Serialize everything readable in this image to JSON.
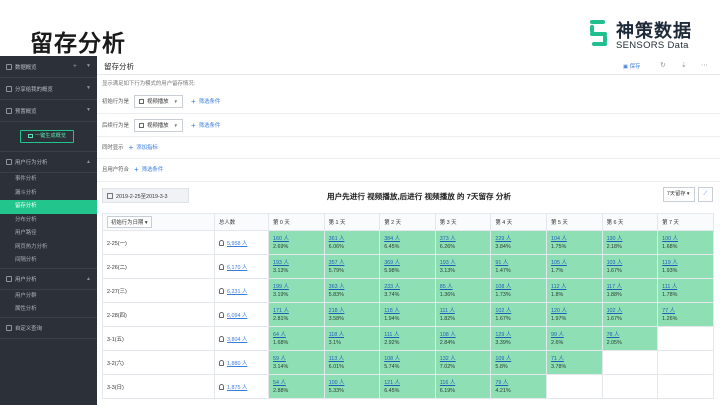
{
  "slide": {
    "title": "留存分析",
    "logo": {
      "cn": "神策数据",
      "en": "SENSORS Data"
    }
  },
  "sidebar": {
    "sections": [
      {
        "label": "数据概览"
      },
      {
        "label": "分享给我的概览"
      },
      {
        "label": "预置概览"
      }
    ],
    "generate_button": "一键生成概览",
    "analysis_section": "用户行为分析",
    "analysis_items": [
      "事件分析",
      "漏斗分析",
      "留存分析",
      "分布分析",
      "用户路径",
      "网页热力分析",
      "间隔分析"
    ],
    "active_item": "留存分析",
    "user_section": "用户分析",
    "user_items": [
      "用户分群",
      "属性分析"
    ],
    "custom_section": "自定义查询"
  },
  "topbar": {
    "title": "留存分析",
    "save_label": "保存",
    "icons": [
      "save-icon",
      "refresh-icon",
      "download-icon",
      "more-icon"
    ]
  },
  "description": "显示满足如下行为模式的用户留存情况:",
  "filters": {
    "initial": {
      "label": "初始行为是",
      "event": "视频播放",
      "add_filter": "筛选条件"
    },
    "return": {
      "label": "后续行为是",
      "event": "视频播放",
      "add_filter": "筛选条件"
    },
    "also_show": {
      "label": "同时显示",
      "add_metric": "添加指标"
    },
    "user_match": {
      "label": "且用户符合",
      "add_filter": "筛选条件"
    }
  },
  "date_range": "2019-2-25至2019-3-3",
  "headline": "用户先进行 视频播放,后进行 视频播放 的 7天留存 分析",
  "retention_select": "7天留存",
  "table": {
    "header": {
      "date_col": "初始行为日期",
      "total_col": "总人数",
      "days": [
        "第 0 天",
        "第 1 天",
        "第 2 天",
        "第 3 天",
        "第 4 天",
        "第 5 天",
        "第 6 天",
        "第 7 天"
      ]
    },
    "rows": [
      {
        "date": "2-25(一)",
        "total": "5,958 人",
        "cells": [
          [
            "160 人",
            "2.69%"
          ],
          [
            "361 人",
            "6.06%"
          ],
          [
            "384 人",
            "6.45%"
          ],
          [
            "373 人",
            "6.26%"
          ],
          [
            "229 人",
            "3.84%"
          ],
          [
            "104 人",
            "1.75%"
          ],
          [
            "130 人",
            "2.18%"
          ],
          [
            "100 人",
            "1.68%"
          ]
        ]
      },
      {
        "date": "2-26(二)",
        "total": "6,170 人",
        "cells": [
          [
            "193 人",
            "3.13%"
          ],
          [
            "357 人",
            "5.79%"
          ],
          [
            "369 人",
            "5.98%"
          ],
          [
            "193 人",
            "3.13%"
          ],
          [
            "91 人",
            "1.47%"
          ],
          [
            "105 人",
            "1.7%"
          ],
          [
            "103 人",
            "1.67%"
          ],
          [
            "119 人",
            "1.93%"
          ]
        ]
      },
      {
        "date": "2-27(三)",
        "total": "6,231 人",
        "cells": [
          [
            "199 人",
            "3.19%"
          ],
          [
            "363 人",
            "5.83%"
          ],
          [
            "233 人",
            "3.74%"
          ],
          [
            "85 人",
            "1.36%"
          ],
          [
            "108 人",
            "1.73%"
          ],
          [
            "112 人",
            "1.8%"
          ],
          [
            "117 人",
            "1.88%"
          ],
          [
            "111 人",
            "1.78%"
          ]
        ]
      },
      {
        "date": "2-28(四)",
        "total": "6,094 人",
        "cells": [
          [
            "171 人",
            "2.81%"
          ],
          [
            "218 人",
            "3.58%"
          ],
          [
            "118 人",
            "1.94%"
          ],
          [
            "111 人",
            "1.82%"
          ],
          [
            "102 人",
            "1.67%"
          ],
          [
            "120 人",
            "1.97%"
          ],
          [
            "102 人",
            "1.67%"
          ],
          [
            "77 人",
            "1.26%"
          ]
        ]
      },
      {
        "date": "3-1(五)",
        "total": "3,804 人",
        "cells": [
          [
            "64 人",
            "1.68%"
          ],
          [
            "118 人",
            "3.1%"
          ],
          [
            "111 人",
            "2.92%"
          ],
          [
            "108 人",
            "2.84%"
          ],
          [
            "129 人",
            "3.39%"
          ],
          [
            "99 人",
            "2.6%"
          ],
          [
            "78 人",
            "2.05%"
          ],
          null
        ]
      },
      {
        "date": "3-2(六)",
        "total": "1,880 人",
        "cells": [
          [
            "59 人",
            "3.14%"
          ],
          [
            "113 人",
            "6.01%"
          ],
          [
            "108 人",
            "5.74%"
          ],
          [
            "132 人",
            "7.02%"
          ],
          [
            "109 人",
            "5.8%"
          ],
          [
            "71 人",
            "3.78%"
          ],
          null,
          null
        ]
      },
      {
        "date": "3-3(日)",
        "total": "1,875 人",
        "cells": [
          [
            "54 人",
            "2.88%"
          ],
          [
            "100 人",
            "5.33%"
          ],
          [
            "121 人",
            "6.45%"
          ],
          [
            "116 人",
            "6.19%"
          ],
          [
            "79 人",
            "4.21%"
          ],
          null,
          null,
          null
        ]
      }
    ]
  },
  "colors": {
    "accent_green": "#22c58b",
    "cell_green": "#8ee0b4",
    "link_blue": "#3b7ddd",
    "sidebar_bg": "#2c3038"
  }
}
